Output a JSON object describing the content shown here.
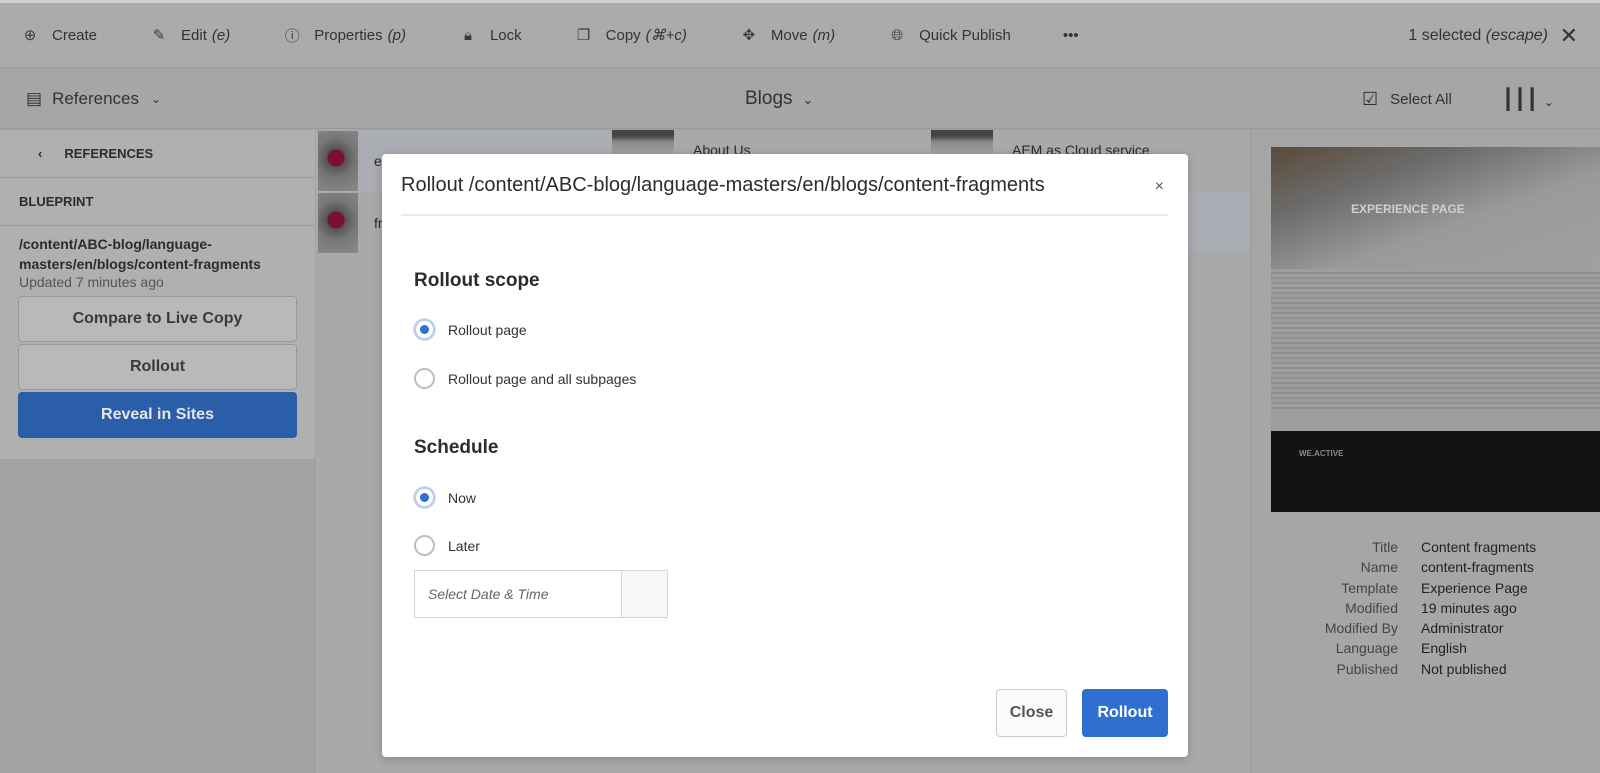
{
  "toolbar": {
    "items": [
      {
        "label": "Create",
        "shortcut": "",
        "icon": "plus-circle-icon"
      },
      {
        "label": "Edit",
        "shortcut": "(e)",
        "icon": "pencil-icon"
      },
      {
        "label": "Properties",
        "shortcut": "(p)",
        "icon": "info-icon"
      },
      {
        "label": "Lock",
        "shortcut": "",
        "icon": "lock-icon"
      },
      {
        "label": "Copy",
        "shortcut": "(⌘+c)",
        "icon": "copy-icon"
      },
      {
        "label": "Move",
        "shortcut": "(m)",
        "icon": "move-icon"
      },
      {
        "label": "Quick Publish",
        "shortcut": "",
        "icon": "globe-icon"
      }
    ],
    "more": "•••",
    "selected": "1 selected",
    "selected_hint": "(escape)",
    "close": "✕"
  },
  "header": {
    "rail": "References",
    "title": "Blogs",
    "select_all": "Select All"
  },
  "sidebar": {
    "back_label": "REFERENCES",
    "section": "BLUEPRINT",
    "path": "/content/ABC-blog/language-masters/en/blogs/content-fragments",
    "updated": "Updated 7 minutes ago",
    "buttons": [
      "Compare to Live Copy",
      "Rollout",
      "Reveal in Sites"
    ]
  },
  "content": {
    "items": [
      "e",
      "fr",
      "About Us",
      "AEM as Cloud service"
    ]
  },
  "preview": {
    "hero_text": "EXPERIENCE PAGE",
    "footer_logo": "WE.ACTIVE",
    "meta": [
      [
        "Title",
        "Content fragments"
      ],
      [
        "Name",
        "content-fragments"
      ],
      [
        "Template",
        "Experience Page"
      ],
      [
        "Modified",
        "19 minutes ago"
      ],
      [
        "Modified By",
        "Administrator"
      ],
      [
        "Language",
        "English"
      ],
      [
        "Published",
        "Not published"
      ]
    ]
  },
  "dialog": {
    "title": "Rollout /content/ABC-blog/language-masters/en/blogs/content-fragments",
    "close_x": "×",
    "scope_heading": "Rollout scope",
    "scope_options": [
      "Rollout page",
      "Rollout page and all subpages"
    ],
    "scope_selected": 0,
    "schedule_heading": "Schedule",
    "schedule_options": [
      "Now",
      "Later"
    ],
    "schedule_selected": 0,
    "date_placeholder": "Select Date & Time",
    "close_button": "Close",
    "rollout_button": "Rollout"
  },
  "colors": {
    "accent": "#2e6fd0"
  }
}
